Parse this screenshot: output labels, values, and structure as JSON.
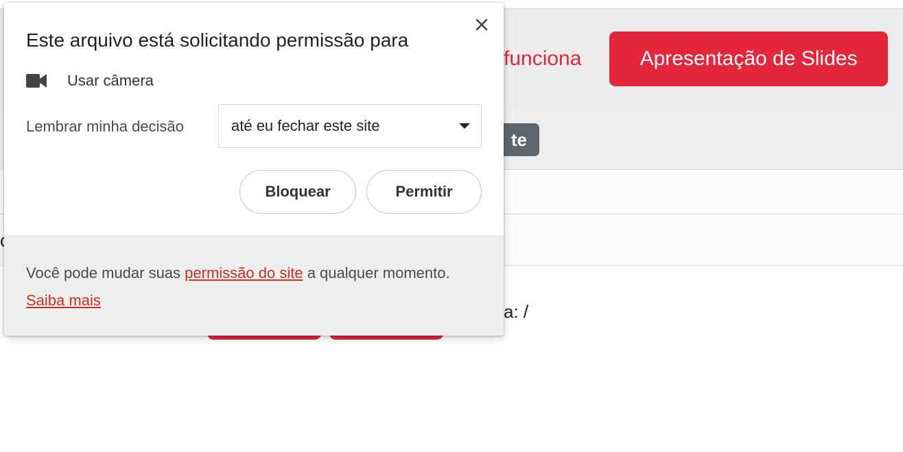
{
  "background": {
    "header_link": "funciona",
    "slides_button": "Apresentação de Slides",
    "badge_text": "te",
    "row4_text": "c",
    "row5_text": "a: /"
  },
  "dialog": {
    "title": "Este arquivo está solicitando permissão para",
    "permission_label": "Usar câmera",
    "permission_icon": "camera-icon",
    "remember_label": "Lembrar minha decisão",
    "remember_value": "até eu fechar este site",
    "block_label": "Bloquear",
    "allow_label": "Permitir",
    "close_symbol": "×",
    "footer": {
      "text_before": "Você pode mudar suas ",
      "link1": "permissão do site",
      "text_middle": " a qualquer momento. ",
      "link2": "Saiba mais"
    }
  },
  "colors": {
    "accent_red": "#e3263a",
    "link_red": "#c5301f",
    "badge_gray": "#5e666d"
  }
}
